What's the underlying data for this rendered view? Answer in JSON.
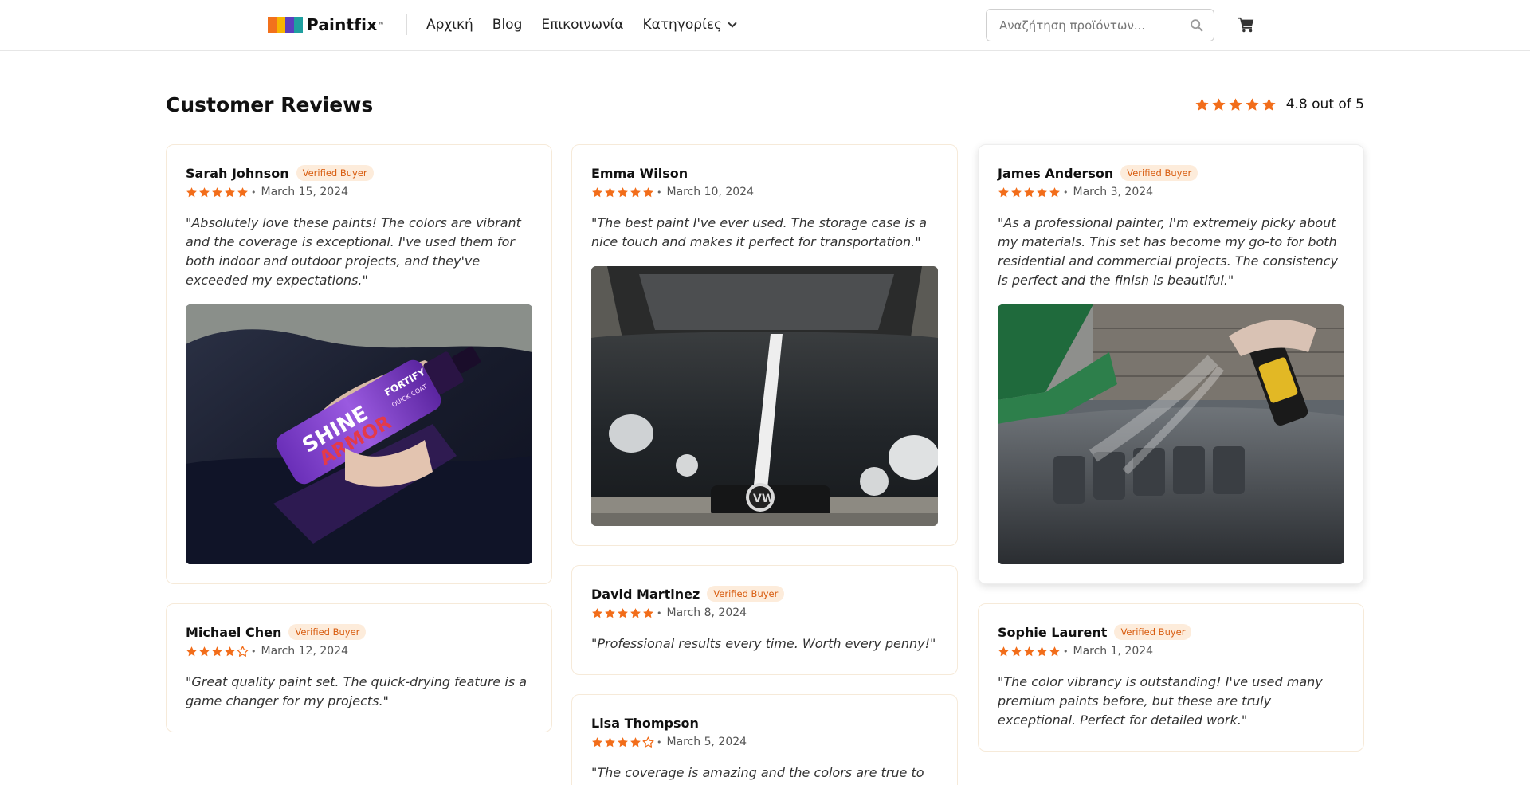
{
  "header": {
    "logo_text": "Paintfix",
    "logo_tm": "™",
    "logo_colors": [
      "#f2711c",
      "#f7b500",
      "#5b3fbf",
      "#1f9fa0"
    ],
    "nav": [
      {
        "label": "Αρχική"
      },
      {
        "label": "Blog"
      },
      {
        "label": "Επικοινωνία"
      },
      {
        "label": "Κατηγορίες"
      }
    ],
    "search_placeholder": "Αναζήτηση προϊόντων...",
    "search_icon": "search-icon",
    "cart_icon": "cart-icon"
  },
  "reviews_section": {
    "title": "Customer Reviews",
    "average_rating": 4.8,
    "average_text": "4.8 out of 5",
    "star_color": "#f26d1a",
    "badge_color": "#d85d10"
  },
  "reviews": [
    {
      "name": "Sarah Johnson",
      "verified": true,
      "badge": "Verified Buyer",
      "rating": 5,
      "date": "March 15, 2024",
      "text": "\"Absolutely love these paints! The colors are vibrant and the coverage is exceptional. I've used them for both indoor and outdoor projects, and they've exceeded my expectations.\"",
      "photo": "purple spray bottle on car",
      "photo_text": [
        "SHINE",
        "ARMOR",
        "FORTIFY",
        "QUICK COAT"
      ]
    },
    {
      "name": "Michael Chen",
      "verified": true,
      "badge": "Verified Buyer",
      "rating": 4,
      "date": "March 12, 2024",
      "text": "\"Great quality paint set. The quick-drying feature is a game changer for my projects.\""
    },
    {
      "name": "Emma Wilson",
      "verified": false,
      "rating": 5,
      "date": "March 10, 2024",
      "text": "\"The best paint I've ever used. The storage case is a nice touch and makes it perfect for transportation.\"",
      "photo": "black car with white stripe"
    },
    {
      "name": "David Martinez",
      "verified": true,
      "badge": "Verified Buyer",
      "rating": 5,
      "date": "March 8, 2024",
      "text": "\"Professional results every time. Worth every penny!\""
    },
    {
      "name": "Lisa Thompson",
      "verified": false,
      "rating": 4,
      "date": "March 5, 2024",
      "text": "\"The coverage is amazing and the colors are true to"
    },
    {
      "name": "James Anderson",
      "verified": true,
      "badge": "Verified Buyer",
      "rating": 5,
      "date": "March 3, 2024",
      "text": "\"As a professional painter, I'm extremely picky about my materials. This set has become my go-to for both residential and commercial projects. The consistency is perfect and the finish is beautiful.\"",
      "photo": "engine bay spray cleaning"
    },
    {
      "name": "Sophie Laurent",
      "verified": true,
      "badge": "Verified Buyer",
      "rating": 5,
      "date": "March 1, 2024",
      "text": "\"The color vibrancy is outstanding! I've used many premium paints before, but these are truly exceptional. Perfect for detailed work.\""
    }
  ]
}
